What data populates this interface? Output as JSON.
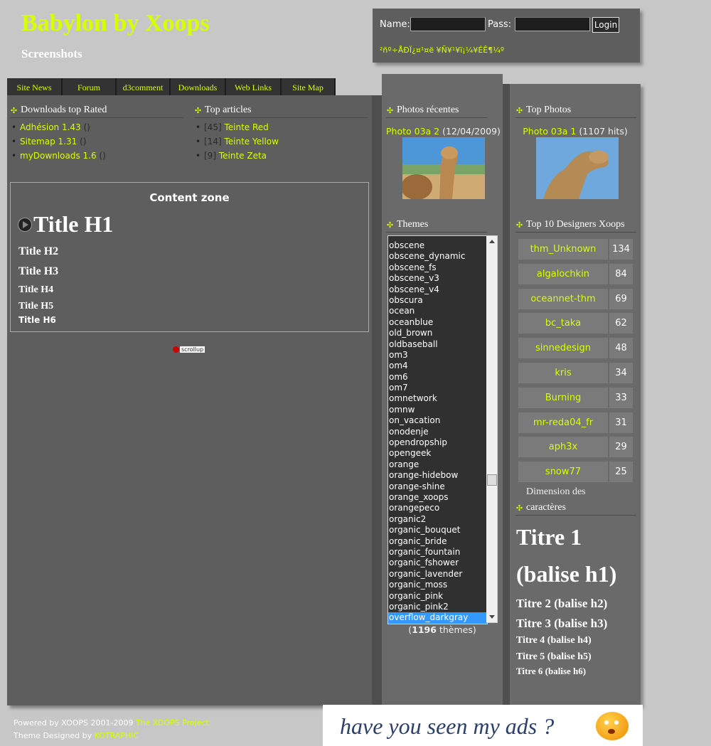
{
  "header": {
    "title": "Babylon by Xoops",
    "slogan": "Screenshots"
  },
  "login": {
    "name_label": "Name:",
    "pass_label": "Pass:",
    "name_value": "",
    "pass_value": "",
    "button": "Login",
    "links": "²ñº÷ÅÐÏ¿¤¹¤ë   ¥Ñ¥¹¥ï¡¼¥ÉÊ¶¼º"
  },
  "nav": {
    "tabs": [
      "Site News",
      "Forum",
      "d3comment",
      "Downloads",
      "Web Links",
      "Site Map"
    ]
  },
  "downloads_block": {
    "title": "Downloads top Rated",
    "items": [
      {
        "name": "Adhésion 1.43",
        "extra": "()"
      },
      {
        "name": "Sitemap 1.31",
        "extra": "()"
      },
      {
        "name": "myDownloads 1.6",
        "extra": "()"
      }
    ]
  },
  "articles_block": {
    "title": "Top articles",
    "items": [
      {
        "count": "[45]",
        "name": "Teinte Red"
      },
      {
        "count": "[14]",
        "name": "Teinte Yellow"
      },
      {
        "count": "[9]",
        "name": "Teinte Zeta"
      }
    ]
  },
  "content_zone": {
    "title": "Content zone",
    "h1": "Title H1",
    "h2": "Title H2",
    "h3": "Title H3",
    "h4": "Title H4",
    "h5": "Title H5",
    "h6": "Title H6"
  },
  "scrollup_label": "scrollup",
  "recent_photos": {
    "title": "Photos récentes",
    "caption_link": "Photo 03a 2",
    "caption_date": "(12/04/2009)"
  },
  "themes": {
    "title": "Themes",
    "options": [
      "obscene",
      "obscene_dynamic",
      "obscene_fs",
      "obscene_v3",
      "obscene_v4",
      "obscura",
      "ocean",
      "oceanblue",
      "old_brown",
      "oldbaseball",
      "om3",
      "om4",
      "om6",
      "om7",
      "omnetwork",
      "omnw",
      "on_vacation",
      "onodenje",
      "opendropship",
      "opengeek",
      "orange",
      "orange-hidebow",
      "orange-shine",
      "orange_xoops",
      "orangepeco",
      "organic2",
      "organic_bouquet",
      "organic_bride",
      "organic_fountain",
      "organic_fshower",
      "organic_lavender",
      "organic_moss",
      "organic_pink",
      "organic_pink2",
      "overflow_darkgray"
    ],
    "selected": "overflow_darkgray",
    "count": "1196",
    "count_suffix": "thèmes"
  },
  "top_photos": {
    "title": "Top Photos",
    "caption_link": "Photo 03a 1",
    "caption_hits": "(1107 hits)"
  },
  "designers": {
    "title": "Top 10 Designers Xoops",
    "rows": [
      {
        "name": "thm_Unknown",
        "count": "134"
      },
      {
        "name": "algalochkin",
        "count": "84"
      },
      {
        "name": "oceannet-thm",
        "count": "69"
      },
      {
        "name": "bc_taka",
        "count": "62"
      },
      {
        "name": "sinnedesign",
        "count": "48"
      },
      {
        "name": "kris",
        "count": "34"
      },
      {
        "name": "Burning",
        "count": "33"
      },
      {
        "name": "mr-reda04_fr",
        "count": "31"
      },
      {
        "name": "aph3x",
        "count": "29"
      },
      {
        "name": "snow77",
        "count": "25"
      }
    ]
  },
  "char_size": {
    "title_line1": "Dimension des",
    "title_line2": "caractères",
    "t1a": "Titre 1",
    "t1b": "(balise h1)",
    "t2": "Titre 2 (balise h2)",
    "t3": "Titre 3 (balise h3)",
    "t4": "Titre 4 (balise h4)",
    "t5": "Titre 5 (balise h5)",
    "t6": "Titre 6 (balise h6)"
  },
  "footer": {
    "line1_prefix": "Powered by XOOPS 2001-2009 ",
    "line1_link": "The XOOPS Project",
    "line2_prefix": "Theme Designed by ",
    "line2_link": "KOTRAPHIC"
  },
  "ad": {
    "text": "have you seen my ads ?"
  },
  "colors": {
    "accent": "#d8ff00",
    "panel": "#5e5e5e",
    "page_bg": "#c7c7c7"
  }
}
